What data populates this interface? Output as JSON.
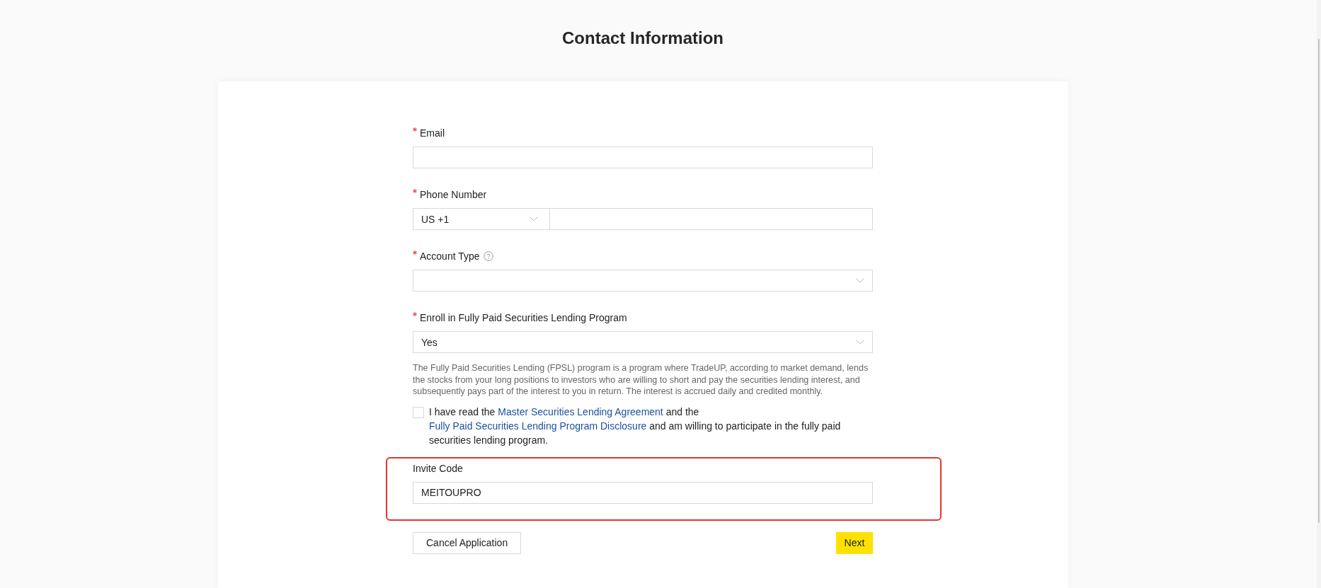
{
  "page": {
    "title": "Contact Information"
  },
  "form_items": [
    {
      "kind": "text",
      "label": "Email",
      "required": true,
      "help": false,
      "highlighted": false
    },
    {
      "kind": "phone",
      "label": "Phone Number",
      "required": true,
      "help": false,
      "highlighted": false,
      "country_code": "US +1"
    },
    {
      "kind": "select",
      "label": "Account Type",
      "required": true,
      "help": true,
      "highlighted": false
    },
    {
      "kind": "select",
      "label": "Enroll in Fully Paid Securities Lending Program",
      "required": true,
      "help": false,
      "highlighted": false,
      "value": "Yes"
    },
    {
      "kind": "note",
      "text": "The Fully Paid Securities Lending (FPSL) program is a program where TradeUP, according to market demand, lends the stocks from your long positions to investors who are willing to short and pay the securities lending interest, and subsequently pays part of the interest to you in return. The interest is accrued daily and credited monthly."
    },
    {
      "kind": "agreement",
      "checked": false,
      "parts": [
        {
          "kind": "text",
          "text": "I have read the "
        },
        {
          "kind": "link",
          "text": "Master Securities Lending Agreement"
        },
        {
          "kind": "text",
          "text": " and the "
        },
        {
          "kind": "link",
          "text": "Fully Paid Securities Lending Program Disclosure"
        },
        {
          "kind": "text",
          "text": " and am willing to participate in the fully paid securities lending program."
        }
      ]
    },
    {
      "kind": "text",
      "label": "Invite Code",
      "required": false,
      "help": false,
      "highlighted": true,
      "value": "MEITOUPRO"
    }
  ],
  "buttons": [
    {
      "kind": "cancel",
      "label": "Cancel Application"
    },
    {
      "kind": "next",
      "label": "Next"
    }
  ]
}
